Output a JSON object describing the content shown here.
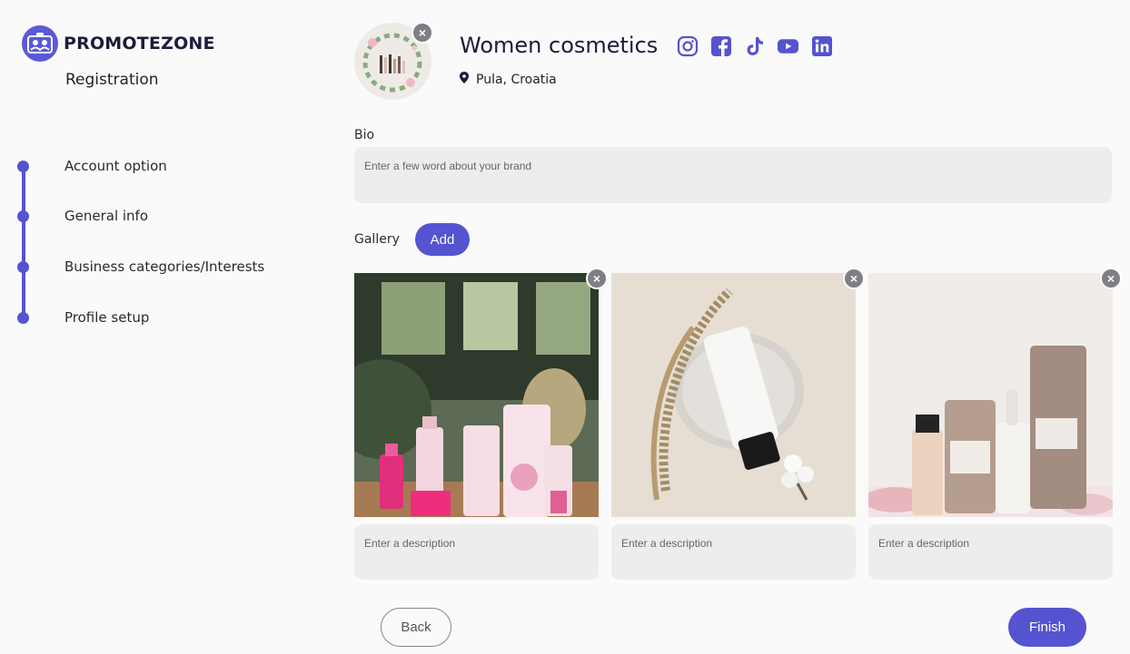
{
  "app": {
    "logo_text": "PROMOTEZONE",
    "subtitle": "Registration",
    "accent_color": "#5553cf"
  },
  "steps": [
    {
      "label": "Account option"
    },
    {
      "label": "General info"
    },
    {
      "label": "Business categories/Interests"
    },
    {
      "label": "Profile setup"
    }
  ],
  "profile": {
    "name": "Women cosmetics",
    "location": "Pula, Croatia",
    "socials": [
      "instagram-icon",
      "facebook-icon",
      "tiktok-icon",
      "youtube-icon",
      "linkedin-icon"
    ]
  },
  "bio": {
    "label": "Bio",
    "placeholder": "Enter a few word about your brand"
  },
  "gallery": {
    "label": "Gallery",
    "add_label": "Add",
    "items": [
      {
        "description_placeholder": "Enter a description"
      },
      {
        "description_placeholder": "Enter a description"
      },
      {
        "description_placeholder": "Enter a description"
      }
    ]
  },
  "footer": {
    "back_label": "Back",
    "finish_label": "Finish"
  }
}
